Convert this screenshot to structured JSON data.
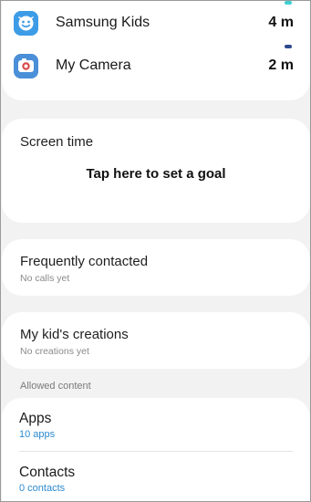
{
  "usage": {
    "apps": [
      {
        "name": "Samsung Kids",
        "time": "4 m",
        "dot_color": "#3fcfd0",
        "icon": "samsung-kids-icon"
      },
      {
        "name": "My Camera",
        "time": "2 m",
        "dot_color": "#2d4a8c",
        "icon": "my-camera-icon"
      }
    ]
  },
  "screen_time": {
    "title": "Screen time",
    "goal_label": "Tap here to set a goal"
  },
  "frequently_contacted": {
    "title": "Frequently contacted",
    "subtitle": "No calls yet"
  },
  "creations": {
    "title": "My kid's creations",
    "subtitle": "No creations yet"
  },
  "allowed_content": {
    "section_label": "Allowed content",
    "apps": {
      "title": "Apps",
      "count": "10 apps"
    },
    "contacts": {
      "title": "Contacts",
      "count": "0 contacts"
    }
  },
  "colors": {
    "accent_link": "#2b8ad1",
    "background": "#f2f2f3",
    "card": "#ffffff"
  }
}
